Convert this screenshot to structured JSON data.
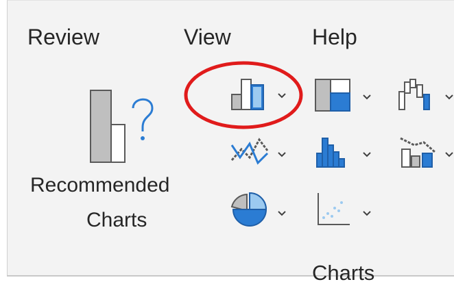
{
  "tabs": [
    {
      "label": "Review"
    },
    {
      "label": "View"
    },
    {
      "label": "Help"
    }
  ],
  "recommended": {
    "line1": "Recommended",
    "line2": "Charts"
  },
  "group": {
    "label": "Charts"
  },
  "colors": {
    "accent_blue": "#2b7cd3",
    "light_blue": "#9ccaf0",
    "gray_fill": "#bfbfbf",
    "highlight_red": "#e01b1b",
    "ribbon_bg": "#f3f3f3"
  }
}
